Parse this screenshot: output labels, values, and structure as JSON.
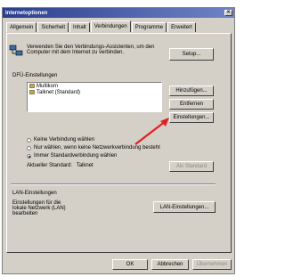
{
  "window": {
    "title": "Internetoptionen",
    "close_glyph": "×"
  },
  "tabs": [
    {
      "label": "Allgemein"
    },
    {
      "label": "Sicherheit"
    },
    {
      "label": "Inhalt"
    },
    {
      "label": "Verbindungen"
    },
    {
      "label": "Programme"
    },
    {
      "label": "Erweitert"
    }
  ],
  "setup": {
    "description": "Verwenden Sie den Verbindungs-Assistenten, um den Computer mit dem Internet zu verbinden.",
    "button": "Setup..."
  },
  "dialup": {
    "title": "DFÜ-Einstellungen",
    "connections": [
      "Multikom",
      "Talknet (Standard)"
    ],
    "add_button": "Hinzufügen...",
    "remove_button": "Entfernen",
    "settings_button": "Einstellungen..."
  },
  "options": {
    "never": "Keine Verbindung wählen",
    "when_none": "Nur wählen, wenn keine Netzwerkverbindung besteht",
    "always": "Immer Standardverbindung wählen",
    "current_label": "Aktueller Standard:",
    "current_value": "Talknet",
    "set_default_button": "Als Standard"
  },
  "lan": {
    "title": "LAN-Einstellungen",
    "description": "Einstellungen für die lokale Netzwerk (LAN) bearbeiten",
    "button": "LAN-Einstellungen..."
  },
  "footer": {
    "ok": "OK",
    "cancel": "Abbrechen",
    "apply": "Übernehmen"
  },
  "colors": {
    "titlebar_start": "#2a3e8c",
    "titlebar_end": "#6f84c6",
    "arrow": "#e02020",
    "face": "#d4d0c8"
  }
}
